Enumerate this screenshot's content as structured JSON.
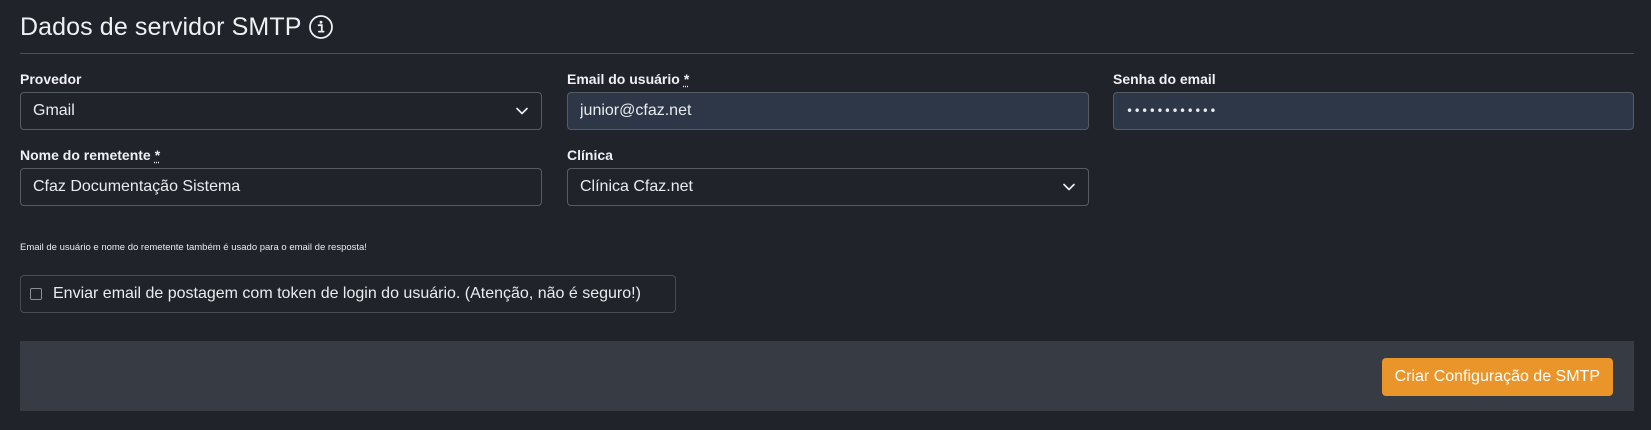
{
  "header": {
    "title": "Dados de servidor SMTP",
    "info_icon": "info-circle-icon"
  },
  "form": {
    "provider": {
      "label": "Provedor",
      "value": "Gmail",
      "icon": "chevron-down-icon"
    },
    "user_email": {
      "label": "Email do usuário",
      "required_mark": "*",
      "value": "junior@cfaz.net"
    },
    "email_password": {
      "label": "Senha do email",
      "value": "••••••••••••"
    },
    "sender_name": {
      "label": "Nome do remetente",
      "required_mark": "*",
      "value": "Cfaz Documentação Sistema"
    },
    "clinic": {
      "label": "Clínica",
      "value": "Clínica Cfaz.net",
      "icon": "chevron-down-icon"
    },
    "note": "Email de usuário e nome do remetente também é usado para o email de resposta!",
    "send_token_checkbox": {
      "label": "Enviar email de postagem com token de login do usuário. (Atenção, não é seguro!)",
      "checked": false
    }
  },
  "footer": {
    "submit_label": "Criar Configuração de SMTP"
  },
  "colors": {
    "background": "#202329",
    "footer_background": "#373b43",
    "accent": "#e9952a",
    "filled_input": "#2e3747"
  }
}
